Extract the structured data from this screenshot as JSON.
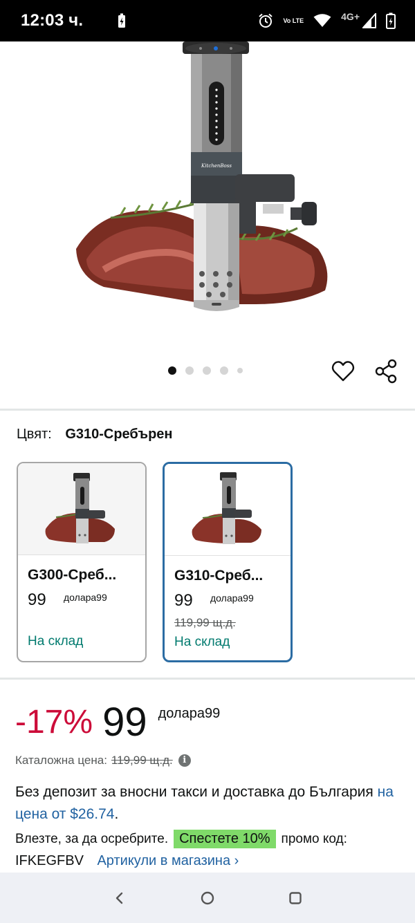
{
  "status_bar": {
    "time": "12:03 ч.",
    "network_label": "Vo LTE",
    "signal_label": "4G+",
    "icons": [
      "battery-saver-icon",
      "alarm-icon",
      "volte-icon",
      "wifi-icon",
      "signal-icon",
      "battery-icon"
    ]
  },
  "gallery": {
    "image_count": 5,
    "active_index": 0,
    "product_logo": "KitchenBoss",
    "icons": [
      "heart-icon",
      "share-icon"
    ]
  },
  "color_selector": {
    "label": "Цвят:",
    "selected_value": "G310-Сребърен"
  },
  "variants": [
    {
      "name": "G300-Среб...",
      "price": "99",
      "currency": "долара99",
      "list_price": "",
      "stock": "На склад"
    },
    {
      "name": "G310-Среб...",
      "price": "99",
      "currency": "долара99",
      "list_price": "119,99 щ.д.",
      "stock": "На склад"
    }
  ],
  "deal": {
    "discount": "-17%",
    "price": "99",
    "currency": "долара99"
  },
  "list_price": {
    "label": "Каталожна цена:",
    "value": "119,99 щ.д."
  },
  "shipping": {
    "text_1": "Без депозит за вносни такси и доставка до България ",
    "link": "на цена от $26.74",
    "text_2": "."
  },
  "promo": {
    "prefix": "Влезте, за да осребрите.",
    "badge": "Спестете 10%",
    "suffix": "промо код:",
    "code": "IFKEGFBV",
    "items_link": "Артикули в магазина ›"
  },
  "colors": {
    "discount": "#cc0c39",
    "link": "#2162a1",
    "in_stock": "#007a6e",
    "selected_border": "#2b6ca3",
    "promo_badge": "#7fda69"
  }
}
